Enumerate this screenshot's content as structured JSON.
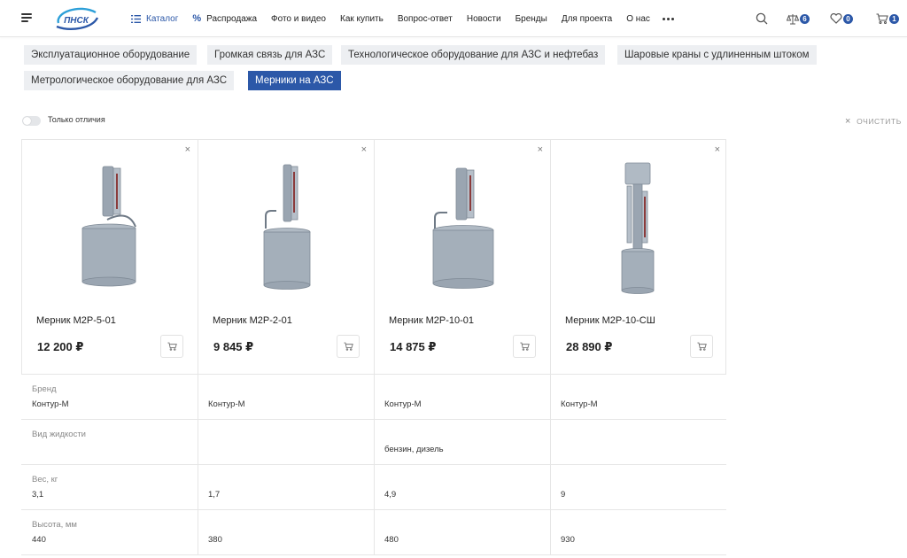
{
  "header": {
    "logo_text": "ПНСК",
    "nav": [
      {
        "label": "Каталог",
        "icon": "list-icon"
      },
      {
        "label": "Распродажа",
        "icon": "percent-icon"
      },
      {
        "label": "Фото и видео"
      },
      {
        "label": "Как купить"
      },
      {
        "label": "Вопрос-ответ"
      },
      {
        "label": "Новости"
      },
      {
        "label": "Бренды"
      },
      {
        "label": "Для проекта"
      },
      {
        "label": "О нас"
      }
    ],
    "compare_count": "6",
    "favorites_count": "0",
    "cart_count": "1",
    "accent_color": "#2c58a8"
  },
  "categories": [
    {
      "label": "Эксплуатационное оборудование",
      "active": false
    },
    {
      "label": "Громкая связь для АЗС",
      "active": false
    },
    {
      "label": "Технологическое оборудование для АЗС и нефтебаз",
      "active": false
    },
    {
      "label": "Шаровые краны с удлиненным штоком",
      "active": false
    },
    {
      "label": "Метрологическое оборудование для АЗС",
      "active": false
    },
    {
      "label": "Мерники на АЗС",
      "active": true
    }
  ],
  "toolbar": {
    "toggle_label": "Только отличия",
    "clear_label": "очистить"
  },
  "products": [
    {
      "name": "Мерник М2Р-5-01",
      "price": "12 200 ₽"
    },
    {
      "name": "Мерник М2Р-2-01",
      "price": "9 845 ₽"
    },
    {
      "name": "Мерник М2Р-10-01",
      "price": "14 875 ₽"
    },
    {
      "name": "Мерник М2Р-10-СШ",
      "price": "28 890 ₽"
    }
  ],
  "properties": [
    {
      "title": "Бренд",
      "values": [
        "Контур-М",
        "Контур-М",
        "Контур-М",
        "Контур-М"
      ]
    },
    {
      "title": "Вид жидкости",
      "values": [
        "",
        "",
        "бензин, дизель",
        ""
      ]
    },
    {
      "title": "Вес, кг",
      "values": [
        "3,1",
        "1,7",
        "4,9",
        "9"
      ]
    },
    {
      "title": "Высота, мм",
      "values": [
        "440",
        "380",
        "480",
        "930"
      ]
    }
  ]
}
